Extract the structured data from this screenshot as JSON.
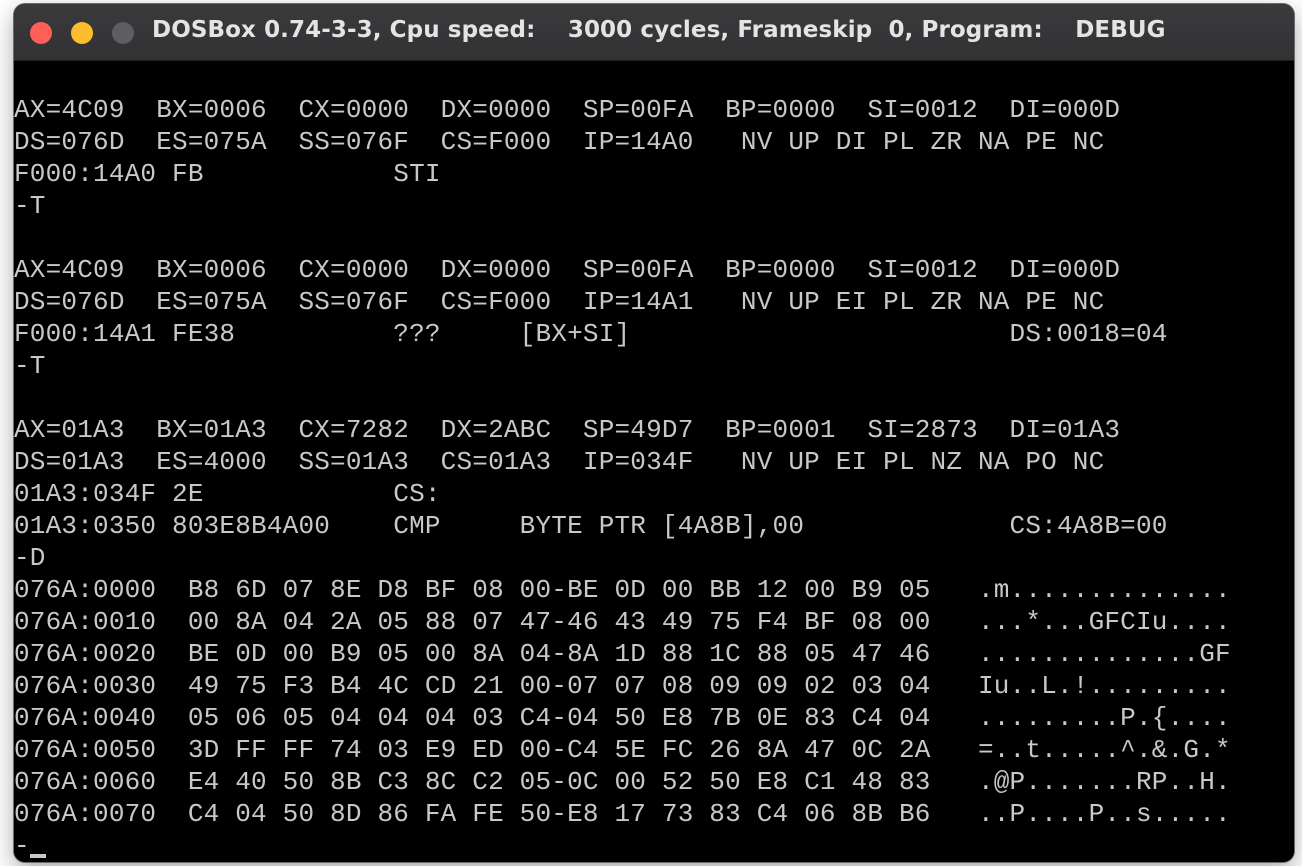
{
  "window": {
    "title": "DOSBox 0.74-3-3, Cpu speed:    3000 cycles, Frameskip  0, Program:    DEBUG"
  },
  "console": {
    "lines": [
      "AX=4C09  BX=0006  CX=0000  DX=0000  SP=00FA  BP=0000  SI=0012  DI=000D",
      "DS=076D  ES=075A  SS=076F  CS=F000  IP=14A0   NV UP DI PL ZR NA PE NC",
      "F000:14A0 FB            STI",
      "-T",
      "",
      "AX=4C09  BX=0006  CX=0000  DX=0000  SP=00FA  BP=0000  SI=0012  DI=000D",
      "DS=076D  ES=075A  SS=076F  CS=F000  IP=14A1   NV UP EI PL ZR NA PE NC",
      "F000:14A1 FE38          ???     [BX+SI]                        DS:0018=04",
      "-T",
      "",
      "AX=01A3  BX=01A3  CX=7282  DX=2ABC  SP=49D7  BP=0001  SI=2873  DI=01A3",
      "DS=01A3  ES=4000  SS=01A3  CS=01A3  IP=034F   NV UP EI PL NZ NA PO NC",
      "01A3:034F 2E            CS:",
      "01A3:0350 803E8B4A00    CMP     BYTE PTR [4A8B],00             CS:4A8B=00",
      "-D",
      "076A:0000  B8 6D 07 8E D8 BF 08 00-BE 0D 00 BB 12 00 B9 05   .m..............",
      "076A:0010  00 8A 04 2A 05 88 07 47-46 43 49 75 F4 BF 08 00   ...*...GFCIu....",
      "076A:0020  BE 0D 00 B9 05 00 8A 04-8A 1D 88 1C 88 05 47 46   ..............GF",
      "076A:0030  49 75 F3 B4 4C CD 21 00-07 07 08 09 09 02 03 04   Iu..L.!.........",
      "076A:0040  05 06 05 04 04 04 03 C4-04 50 E8 7B 0E 83 C4 04   .........P.{....",
      "076A:0050  3D FF FF 74 03 E9 ED 00-C4 5E FC 26 8A 47 0C 2A   =..t.....^.&.G.*",
      "076A:0060  E4 40 50 8B C3 8C C2 05-0C 00 52 50 E8 C1 48 83   .@P.......RP..H.",
      "076A:0070  C4 04 50 8D 86 FA FE 50-E8 17 73 83 C4 06 8B B6   ..P....P..s.....",
      "-"
    ]
  }
}
